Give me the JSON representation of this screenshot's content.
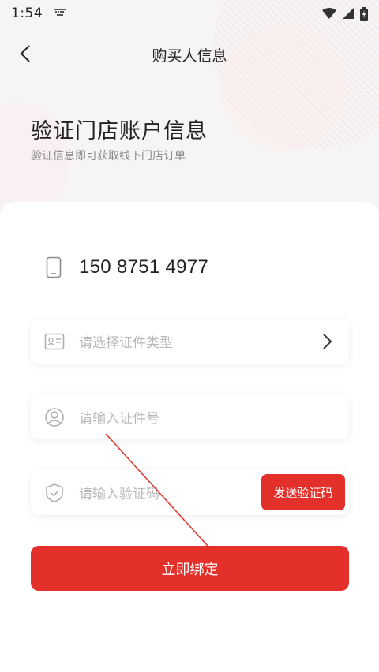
{
  "status_bar": {
    "time": "1:54"
  },
  "nav": {
    "title": "购买人信息"
  },
  "hero": {
    "title": "验证门店账户信息",
    "subtitle": "验证信息即可获取线下门店订单"
  },
  "phone": {
    "number": "150 8751 4977"
  },
  "form": {
    "id_type_placeholder": "请选择证件类型",
    "id_number_placeholder": "请输入证件号",
    "code_placeholder": "请输入验证码",
    "send_code_label": "发送验证码"
  },
  "submit": {
    "label": "立即绑定"
  },
  "colors": {
    "accent": "#e3302a",
    "card": "#ffffff",
    "background": "#f6f4f5"
  }
}
